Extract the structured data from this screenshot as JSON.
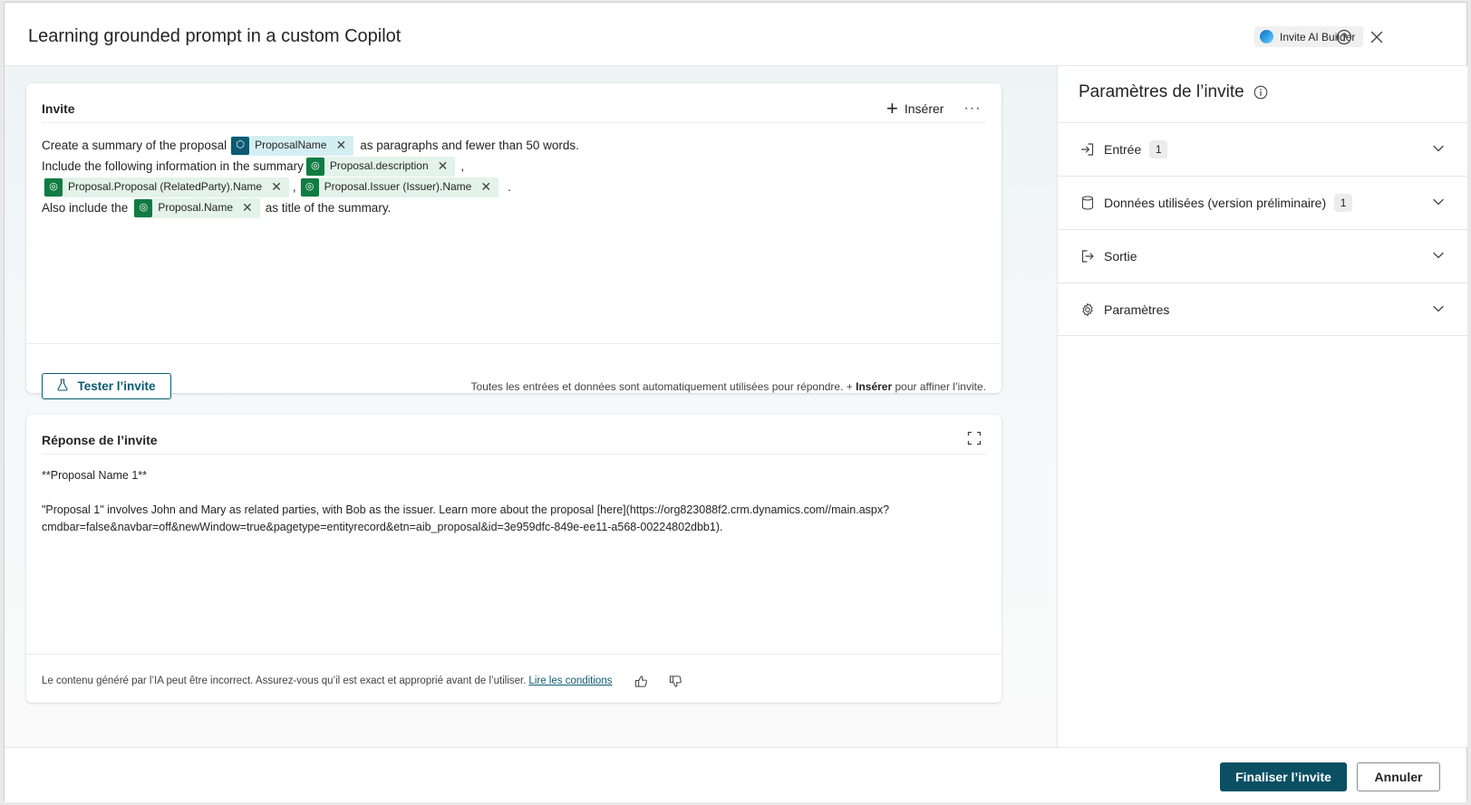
{
  "window": {
    "title": "Learning grounded prompt in a custom Copilot",
    "ai_badge": "Invite AI Builder"
  },
  "prompt_card": {
    "title": "Invite",
    "insert_label": "Insérer",
    "more_label": "···",
    "line1": {
      "text_before": "Create a summary of the proposal",
      "chip": "ProposalName",
      "text_after": "as paragraphs and fewer than 50 words."
    },
    "line2": {
      "text_before": "Include the following information in the summary",
      "chip": "Proposal.description",
      "text_after": ","
    },
    "line3": {
      "chip1": "Proposal.Proposal (RelatedParty).Name",
      "sep": ",",
      "chip2": "Proposal.Issuer (Issuer).Name",
      "text_after": "."
    },
    "line4": {
      "text_before": "Also include the",
      "chip": "Proposal.Name",
      "text_after": "as title of the summary."
    },
    "test_button": "Tester l’invite",
    "footer_note_prefix": "Toutes les entrées et données sont automatiquement utilisées pour répondre. + ",
    "footer_note_bold": "Insérer",
    "footer_note_suffix": " pour affiner l’invite."
  },
  "response_card": {
    "title": "Réponse de l’invite",
    "line1": "**Proposal Name 1**",
    "line2": "\"Proposal 1\" involves John and Mary as related parties, with Bob as the issuer. Learn more about the proposal [here](https://org823088f2.crm.dynamics.com//main.aspx?",
    "line3": "cmdbar=false&navbar=off&newWindow=true&pagetype=entityrecord&etn=aib_proposal&id=3e959dfc-849e-ee11-a568-00224802dbb1).",
    "disclaimer": "Le contenu généré par l’IA peut être incorrect. Assurez-vous qu’il est exact et approprié avant de l’utiliser.",
    "terms_link": "Lire les conditions"
  },
  "settings_pane": {
    "title": "Paramètres de l’invite",
    "sections": [
      {
        "label": "Entrée",
        "count": "1",
        "icon": "sign-in-icon"
      },
      {
        "label": "Données utilisées (version préliminaire)",
        "count": "1",
        "icon": "database-icon"
      },
      {
        "label": "Sortie",
        "icon": "sign-out-icon"
      },
      {
        "label": "Paramètres",
        "icon": "gear-icon"
      }
    ]
  },
  "footer": {
    "primary": "Finaliser l’invite",
    "secondary": "Annuler"
  },
  "colors": {
    "accent": "#0b4f63",
    "chip_green": "#107c41",
    "chip_bg": "#e3f3ea",
    "chip_blue_bg": "#d4eff3"
  }
}
